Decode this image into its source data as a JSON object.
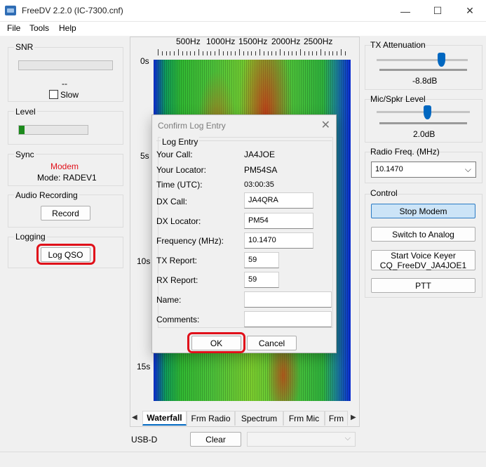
{
  "window": {
    "title": "FreeDV 2.2.0 (IC-7300.cnf)",
    "minimize": "—",
    "maximize": "☐",
    "close": "✕"
  },
  "menu": [
    "File",
    "Tools",
    "Help"
  ],
  "snr": {
    "title": "SNR",
    "value": "--",
    "slow_label": "Slow"
  },
  "level": {
    "title": "Level",
    "level_fraction": 0.08,
    "level_color": "#1c8a1c"
  },
  "sync": {
    "title": "Sync",
    "status": "Modem",
    "status_color": "#e0101a",
    "mode": "Mode: RADEV1"
  },
  "audio_recording": {
    "title": "Audio Recording",
    "record_button": "Record"
  },
  "logging": {
    "title": "Logging",
    "log_qso_button": "Log QSO"
  },
  "spectrum": {
    "freq_labels": [
      "500Hz",
      "1000Hz",
      "1500Hz",
      "2000Hz",
      "2500Hz"
    ],
    "time_labels": [
      "0s",
      "5s",
      "10s",
      "15s"
    ]
  },
  "tabs": {
    "items": [
      "Waterfall",
      "Frm Radio",
      "Spectrum",
      "Frm Mic",
      "Frm"
    ],
    "active": "Waterfall",
    "prev_arrow": "◀",
    "next_arrow": "▶"
  },
  "bottom": {
    "mode_label": "USB-D",
    "clear_button": "Clear"
  },
  "tx_attenuation": {
    "title": "TX Attenuation",
    "value": "-8.8dB",
    "slider_fraction": 0.7
  },
  "mic_spkr": {
    "title": "Mic/Spkr Level",
    "value": "2.0dB",
    "slider_fraction": 0.55
  },
  "radio_freq": {
    "title": "Radio Freq. (MHz)",
    "value": "10.1470"
  },
  "control": {
    "title": "Control",
    "stop_modem": "Stop Modem",
    "switch_analog": "Switch to Analog",
    "voice_keyer_line1": "Start Voice Keyer",
    "voice_keyer_line2": "CQ_FreeDV_JA4JOE1",
    "ptt": "PTT",
    "accent": "#cce4f7"
  },
  "dialog": {
    "title": "Confirm Log Entry",
    "group": "Log Entry",
    "your_call_label": "Your Call:",
    "your_call": "JA4JOE",
    "your_locator_label": "Your Locator:",
    "your_locator": "PM54SA",
    "time_label": "Time (UTC):",
    "time": "03:00:35",
    "dx_call_label": "DX Call:",
    "dx_call": "JA4QRA",
    "dx_locator_label": "DX Locator:",
    "dx_locator": "PM54",
    "frequency_label": "Frequency (MHz):",
    "frequency": "10.1470",
    "tx_report_label": "TX Report:",
    "tx_report": "59",
    "rx_report_label": "RX Report:",
    "rx_report": "59",
    "name_label": "Name:",
    "name": "",
    "comments_label": "Comments:",
    "comments": "",
    "ok_button": "OK",
    "cancel_button": "Cancel"
  }
}
